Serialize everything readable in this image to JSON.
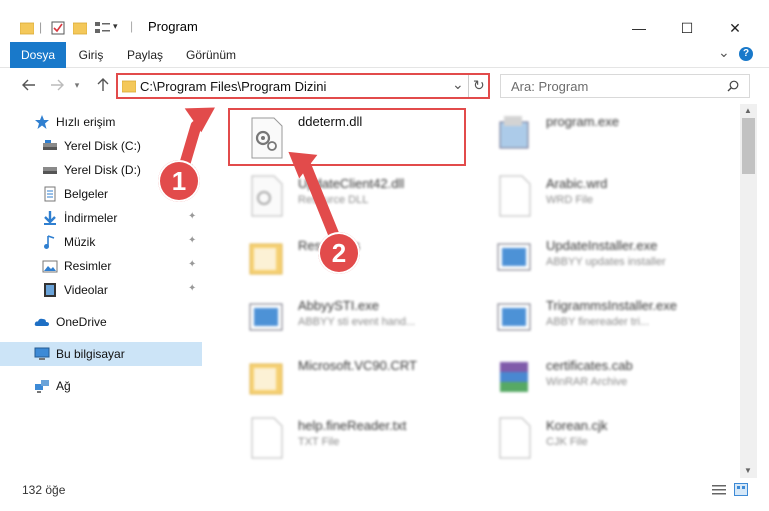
{
  "window": {
    "title": "Program",
    "minimize_glyph": "—",
    "maximize_glyph": "☐",
    "close_glyph": "✕"
  },
  "ribbon": {
    "tabs": [
      {
        "label": "Dosya",
        "active": true
      },
      {
        "label": "Giriş",
        "active": false
      },
      {
        "label": "Paylaş",
        "active": false
      },
      {
        "label": "Görünüm",
        "active": false
      }
    ],
    "help_glyph": "?",
    "expand_glyph": "⌄"
  },
  "address": {
    "path": "C:\\Program Files\\Program Dizini",
    "dropdown_glyph": "⌄",
    "refresh_glyph": "↻"
  },
  "search": {
    "placeholder": "Ara: Program"
  },
  "sidebar": {
    "items": [
      {
        "label": "Hızlı erişim",
        "icon": "star-icon"
      },
      {
        "label": "Yerel Disk (C:)",
        "icon": "disk-icon"
      },
      {
        "label": "Yerel Disk (D:)",
        "icon": "disk-icon"
      },
      {
        "label": "Belgeler",
        "icon": "documents-icon"
      },
      {
        "label": "İndirmeler",
        "icon": "download-icon"
      },
      {
        "label": "Müzik",
        "icon": "music-icon"
      },
      {
        "label": "Resimler",
        "icon": "pictures-icon"
      },
      {
        "label": "Videolar",
        "icon": "video-icon"
      },
      {
        "label": "OneDrive",
        "icon": "cloud-icon"
      },
      {
        "label": "Bu bilgisayar",
        "icon": "computer-icon"
      },
      {
        "label": "Ağ",
        "icon": "network-icon"
      }
    ]
  },
  "files": [
    {
      "name": "ddeterm.dll",
      "type": ""
    },
    {
      "name": "program.exe",
      "type": ""
    },
    {
      "name": "UpdateClient42.dll",
      "type": "Resource DLL"
    },
    {
      "name": "Arabic.wrd",
      "type": "WRD File"
    },
    {
      "name": "Resources",
      "type": ""
    },
    {
      "name": "UpdateInstaller.exe",
      "type": "ABBYY updates installer"
    },
    {
      "name": "AbbyySTI.exe",
      "type": "ABBYY sti event hand..."
    },
    {
      "name": "TrigrammsInstaller.exe",
      "type": "ABBY finereader tri..."
    },
    {
      "name": "Microsoft.VC90.CRT",
      "type": ""
    },
    {
      "name": "certificates.cab",
      "type": "WinRAR Archive"
    },
    {
      "name": "help.fineReader.txt",
      "type": "TXT File"
    },
    {
      "name": "Korean.cjk",
      "type": "CJK File"
    }
  ],
  "status": {
    "item_count": "132 öğe"
  },
  "annotations": {
    "callout_1": "1",
    "callout_2": "2"
  },
  "colors": {
    "accent": "#1979ca",
    "annotation": "#e24b4b",
    "selection": "#cce4f7",
    "folder": "#f4c85a"
  }
}
